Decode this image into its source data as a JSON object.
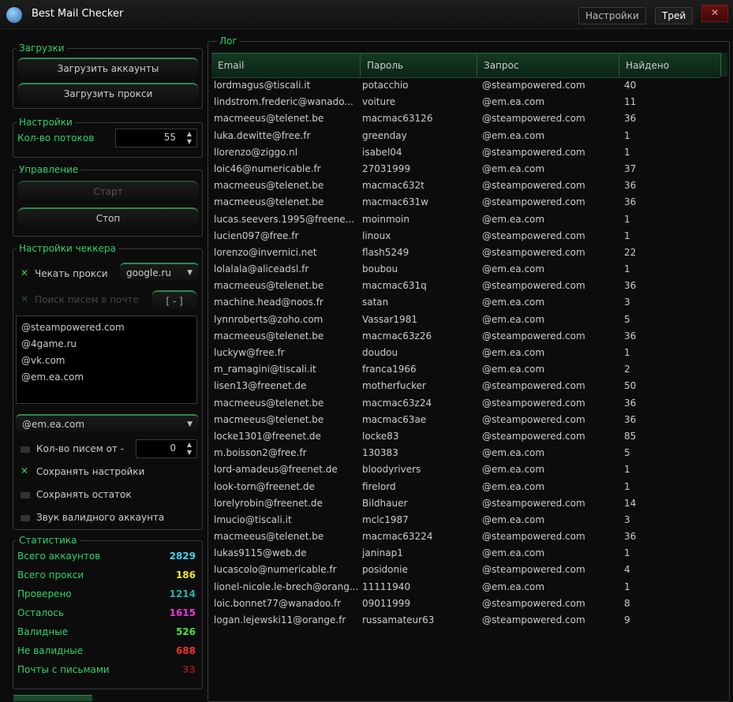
{
  "window": {
    "title": "Best Mail Checker",
    "settings_label": "Настройки",
    "tray_label": "Трей",
    "close_label": "✕"
  },
  "downloads": {
    "legend": "Загрузки",
    "load_accounts": "Загрузить аккаунты",
    "load_proxies": "Загрузить прокси"
  },
  "settings": {
    "legend": "Настройки",
    "threads_label": "Кол-во потоков",
    "threads_value": "55"
  },
  "control": {
    "legend": "Управление",
    "start": "Старт",
    "stop": "Стоп"
  },
  "checker": {
    "legend": "Настройки чеккера",
    "check_proxy_label": "Чекать прокси",
    "proxy_site": "google.ru",
    "search_mail_label": "Поиск писем в почте",
    "search_mail_button": "[ - ]",
    "domains": [
      "@steampowered.com",
      "@4game.ru",
      "@vk.com",
      "@em.ea.com"
    ],
    "selected_domain": "@em.ea.com",
    "mail_count_label": "Кол-во писем от -",
    "mail_count_value": "0",
    "save_settings_label": "Сохранять настройки",
    "save_rest_label": "Сохранять остаток",
    "sound_label": "Звук валидного аккаунта"
  },
  "stats": {
    "legend": "Статистика",
    "items": [
      {
        "label": "Всего аккаунтов",
        "value": "2829",
        "color": "#33d6f0"
      },
      {
        "label": "Всего прокси",
        "value": "186",
        "color": "#f0e632"
      },
      {
        "label": "Проверено",
        "value": "1214",
        "color": "#2ab0a6"
      },
      {
        "label": "Осталось",
        "value": "1615",
        "color": "#e23ad6"
      },
      {
        "label": "Валидные",
        "value": "526",
        "color": "#48e040"
      },
      {
        "label": "Не валидные",
        "value": "688",
        "color": "#f03030"
      },
      {
        "label": "Почты с письмами",
        "value": "33",
        "color": "#8a1616"
      }
    ]
  },
  "log": {
    "legend": "Лог",
    "columns": [
      "Email",
      "Пароль",
      "Запрос",
      "Найдено"
    ],
    "rows": [
      [
        "lordmagus@tiscali.it",
        "potacchio",
        "@steampowered.com",
        "40"
      ],
      [
        "lindstrom.frederic@wanado...",
        "voiture",
        "@em.ea.com",
        "11"
      ],
      [
        "macmeeus@telenet.be",
        "macmac63126",
        "@steampowered.com",
        "36"
      ],
      [
        "luka.dewitte@free.fr",
        "greenday",
        "@em.ea.com",
        "1"
      ],
      [
        "llorenzo@ziggo.nl",
        "isabel04",
        "@steampowered.com",
        "1"
      ],
      [
        "loic46@numericable.fr",
        "27031999",
        "@em.ea.com",
        "37"
      ],
      [
        "macmeeus@telenet.be",
        "macmac632t",
        "@steampowered.com",
        "36"
      ],
      [
        "macmeeus@telenet.be",
        "macmac631w",
        "@steampowered.com",
        "36"
      ],
      [
        "lucas.seevers.1995@freene...",
        "moinmoin",
        "@em.ea.com",
        "1"
      ],
      [
        "lucien097@free.fr",
        "linoux",
        "@steampowered.com",
        "1"
      ],
      [
        "lorenzo@invernici.net",
        "flash5249",
        "@steampowered.com",
        "22"
      ],
      [
        "lolalala@aliceadsl.fr",
        "boubou",
        "@em.ea.com",
        "1"
      ],
      [
        "macmeeus@telenet.be",
        "macmac631q",
        "@steampowered.com",
        "36"
      ],
      [
        "machine.head@noos.fr",
        "satan",
        "@em.ea.com",
        "3"
      ],
      [
        "lynnroberts@zoho.com",
        "Vassar1981",
        "@em.ea.com",
        "5"
      ],
      [
        "macmeeus@telenet.be",
        "macmac63z26",
        "@steampowered.com",
        "36"
      ],
      [
        "luckyw@free.fr",
        "doudou",
        "@em.ea.com",
        "1"
      ],
      [
        "m_ramagini@tiscali.it",
        "franca1966",
        "@em.ea.com",
        "2"
      ],
      [
        "lisen13@freenet.de",
        "motherfucker",
        "@steampowered.com",
        "50"
      ],
      [
        "macmeeus@telenet.be",
        "macmac63z24",
        "@steampowered.com",
        "36"
      ],
      [
        "macmeeus@telenet.be",
        "macmac63ae",
        "@steampowered.com",
        "36"
      ],
      [
        "locke1301@freenet.de",
        "locke83",
        "@steampowered.com",
        "85"
      ],
      [
        "m.boisson2@free.fr",
        "130383",
        "@em.ea.com",
        "5"
      ],
      [
        "lord-amadeus@freenet.de",
        "bloodyrivers",
        "@em.ea.com",
        "1"
      ],
      [
        "look-torn@freenet.de",
        "firelord",
        "@em.ea.com",
        "1"
      ],
      [
        "lorelyrobin@freenet.de",
        "Bildhauer",
        "@steampowered.com",
        "14"
      ],
      [
        "lmucio@tiscali.it",
        "mclc1987",
        "@em.ea.com",
        "3"
      ],
      [
        "macmeeus@telenet.be",
        "macmac63224",
        "@steampowered.com",
        "36"
      ],
      [
        "lukas9115@web.de",
        "janinap1",
        "@em.ea.com",
        "1"
      ],
      [
        "lucascolo@numericable.fr",
        "posidonie",
        "@steampowered.com",
        "4"
      ],
      [
        "lionel-nicole.le-brech@orang...",
        "11111940",
        "@em.ea.com",
        "1"
      ],
      [
        "loic.bonnet77@wanadoo.fr",
        "09011999",
        "@steampowered.com",
        "8"
      ],
      [
        "logan.lejewski11@orange.fr",
        "russamateur63",
        "@steampowered.com",
        "9"
      ]
    ]
  }
}
